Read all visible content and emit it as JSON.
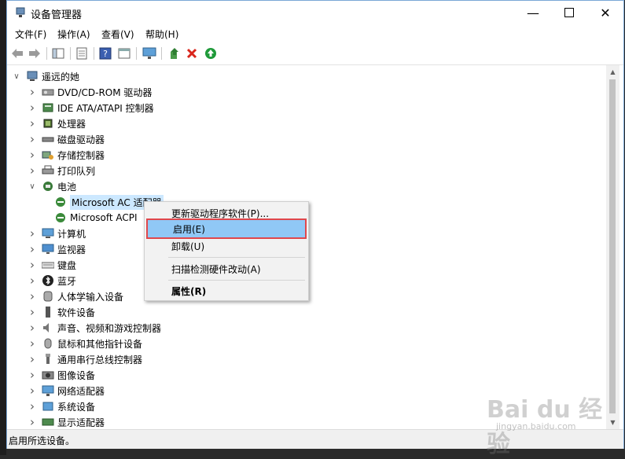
{
  "window": {
    "title": "设备管理器"
  },
  "menu": [
    "文件(F)",
    "操作(A)",
    "查看(V)",
    "帮助(H)"
  ],
  "tree": {
    "root": "遥远的她",
    "items": [
      {
        "label": "DVD/CD-ROM 驱动器",
        "icon": "dvd-drive-icon"
      },
      {
        "label": "IDE ATA/ATAPI 控制器",
        "icon": "ide-controller-icon"
      },
      {
        "label": "处理器",
        "icon": "processor-icon"
      },
      {
        "label": "磁盘驱动器",
        "icon": "disk-drive-icon"
      },
      {
        "label": "存储控制器",
        "icon": "storage-controller-icon"
      },
      {
        "label": "打印队列",
        "icon": "printer-icon"
      },
      {
        "label": "电池",
        "icon": "battery-icon",
        "expanded": true
      },
      {
        "label": "Microsoft AC 适配器",
        "icon": "battery-device-icon",
        "child": true,
        "selected": true
      },
      {
        "label": "Microsoft ACPI",
        "icon": "battery-device-icon",
        "child": true
      },
      {
        "label": "计算机",
        "icon": "computer-icon"
      },
      {
        "label": "监视器",
        "icon": "monitor-icon"
      },
      {
        "label": "键盘",
        "icon": "keyboard-icon"
      },
      {
        "label": "蓝牙",
        "icon": "bluetooth-icon"
      },
      {
        "label": "人体学输入设备",
        "icon": "hid-icon"
      },
      {
        "label": "软件设备",
        "icon": "software-device-icon"
      },
      {
        "label": "声音、视频和游戏控制器",
        "icon": "sound-icon"
      },
      {
        "label": "鼠标和其他指针设备",
        "icon": "mouse-icon"
      },
      {
        "label": "通用串行总线控制器",
        "icon": "usb-icon"
      },
      {
        "label": "图像设备",
        "icon": "camera-icon"
      },
      {
        "label": "网络适配器",
        "icon": "network-adapter-icon"
      },
      {
        "label": "系统设备",
        "icon": "system-device-icon"
      },
      {
        "label": "显示适配器",
        "icon": "display-adapter-icon"
      }
    ]
  },
  "context_menu": {
    "update": "更新驱动程序软件(P)...",
    "enable": "启用(E)",
    "uninstall": "卸载(U)",
    "scan": "扫描检测硬件改动(A)",
    "properties": "属性(R)"
  },
  "status": "启用所选设备。",
  "watermark": {
    "main": "Bai du 经验",
    "sub": "jingyan.baidu.com"
  },
  "colors": {
    "selection": "#cce8ff",
    "menu_highlight": "#90c8f6",
    "highlight_border": "#e0474c"
  }
}
